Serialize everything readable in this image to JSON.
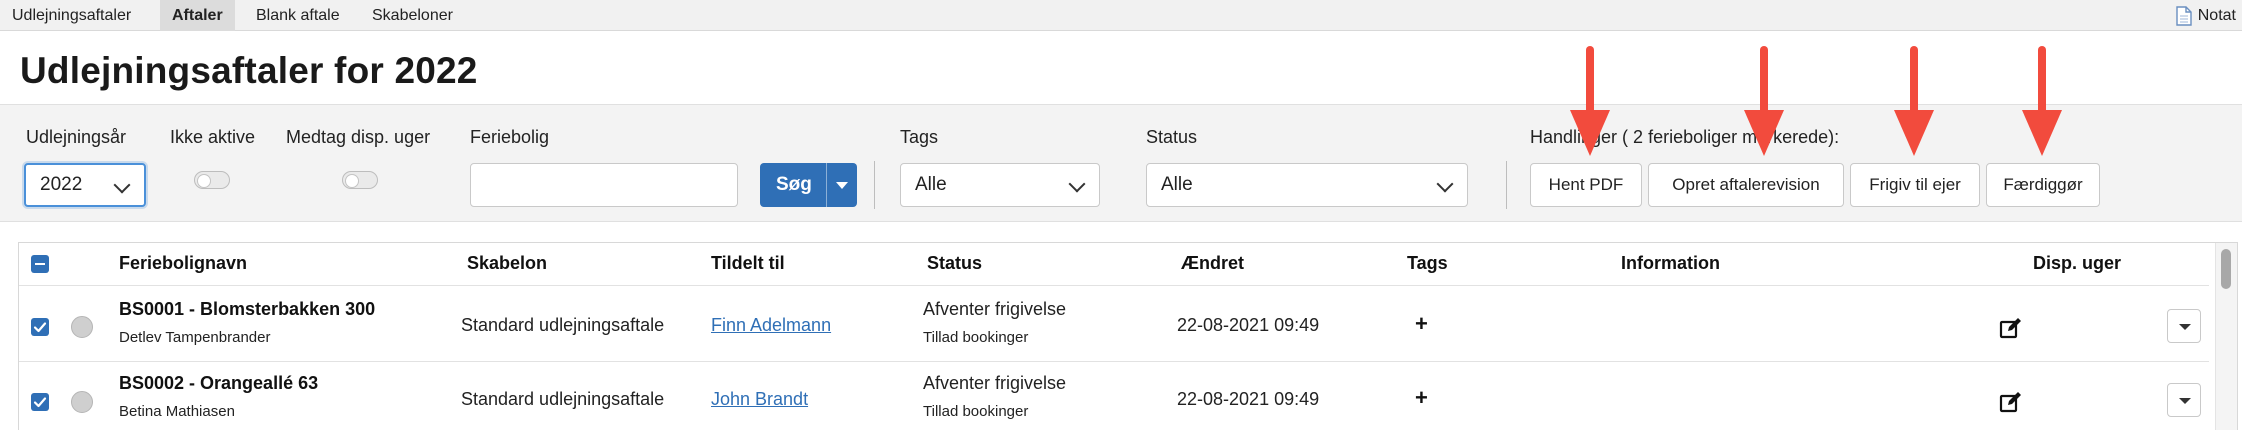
{
  "top_tabs": [
    {
      "label": "Udlejningsaftaler",
      "active": false
    },
    {
      "label": "Aftaler",
      "active": true
    },
    {
      "label": "Blank aftale",
      "active": false
    },
    {
      "label": "Skabeloner",
      "active": false
    }
  ],
  "notat_label": "Notat",
  "page_title": "Udlejningsaftaler for 2022",
  "filters": {
    "year_label": "Udlejningsår",
    "year_value": "2022",
    "inactive_label": "Ikke aktive",
    "include_weeks_label": "Medtag disp. uger",
    "property_label": "Feriebolig",
    "property_value": "",
    "search_button": "Søg",
    "tags_label": "Tags",
    "tags_value": "Alle",
    "status_label": "Status",
    "status_value": "Alle"
  },
  "actions": {
    "label": "Handlinger ( 2 ferieboliger markerede):",
    "buttons": [
      "Hent PDF",
      "Opret aftalerevision",
      "Frigiv til ejer",
      "Færdiggør"
    ]
  },
  "annotation_color": "#f24b3d",
  "table": {
    "headers": [
      "Feriebolignavn",
      "Skabelon",
      "Tildelt til",
      "Status",
      "Ændret",
      "Tags",
      "Information",
      "Disp. uger"
    ],
    "rows": [
      {
        "name": "BS0001 - Blomsterbakken 300",
        "owner": "Detlev Tampenbrander",
        "template": "Standard udlejningsaftale",
        "assigned_to": "Finn Adelmann",
        "status": "Afventer frigivelse",
        "status_sub": "Tillad bookinger",
        "changed": "22-08-2021 09:49",
        "tags": "+",
        "information": ""
      },
      {
        "name": "BS0002 - Orangeallé 63",
        "owner": "Betina Mathiasen",
        "template": "Standard udlejningsaftale",
        "assigned_to": "John Brandt",
        "status": "Afventer frigivelse",
        "status_sub": "Tillad bookinger",
        "changed": "22-08-2021 09:49",
        "tags": "+",
        "information": ""
      }
    ]
  }
}
